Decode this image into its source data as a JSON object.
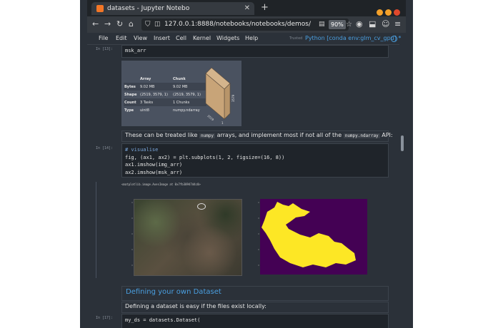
{
  "browser": {
    "tab_title": "datasets - Jupyter Notebo",
    "url": "127.0.0.1:8888/notebooks/notebooks/demos/",
    "zoom": "90%"
  },
  "menu": [
    "File",
    "Edit",
    "View",
    "Insert",
    "Cell",
    "Kernel",
    "Widgets",
    "Help"
  ],
  "trusted": "Trusted",
  "kernel": "Python [conda env:glm_cv_gpu] *",
  "cells": {
    "c1": {
      "prompt": "In [13]:",
      "code": "msk_arr"
    },
    "dask_table": {
      "headers": [
        "",
        "Array",
        "Chunk"
      ],
      "rows": [
        [
          "Bytes",
          "9.02 MB",
          "9.02 MB"
        ],
        [
          "Shape",
          "(2519, 3579, 1)",
          "(2519, 3579, 1)"
        ],
        [
          "Count",
          "3 Tasks",
          "1 Chunks"
        ],
        [
          "Type",
          "uint8",
          "numpy.ndarray"
        ]
      ],
      "cube_labels": [
        "3579",
        "2519",
        "1"
      ]
    },
    "md1": {
      "pre": "These can be treated like",
      "c1": "numpy",
      "mid": "arrays, and implement most if not all of the",
      "c2": "numpy.ndarray",
      "post": "API:"
    },
    "c2": {
      "prompt": "In [14]:",
      "comment": "# visualise",
      "line1": "fig, (ax1, ax2) = plt.subplots(1, 2, figsize=(16, 8))",
      "line2": "ax1.imshow(img_arr)",
      "line3": "ax2.imshow(msk_arr)"
    },
    "out2": {
      "text": "<matplotlib.image.AxesImage at 0x7fb30947d4c0>"
    },
    "heading": "Defining your own Dataset",
    "md2": "Defining a dataset is easy if the files exist locally:",
    "c3": {
      "prompt": "In [17]:",
      "code": "my_ds = datasets.Dataset("
    }
  },
  "colors": {
    "accent": "#4a9fe0",
    "mask_bg": "#440154",
    "mask_fg": "#fde725"
  }
}
